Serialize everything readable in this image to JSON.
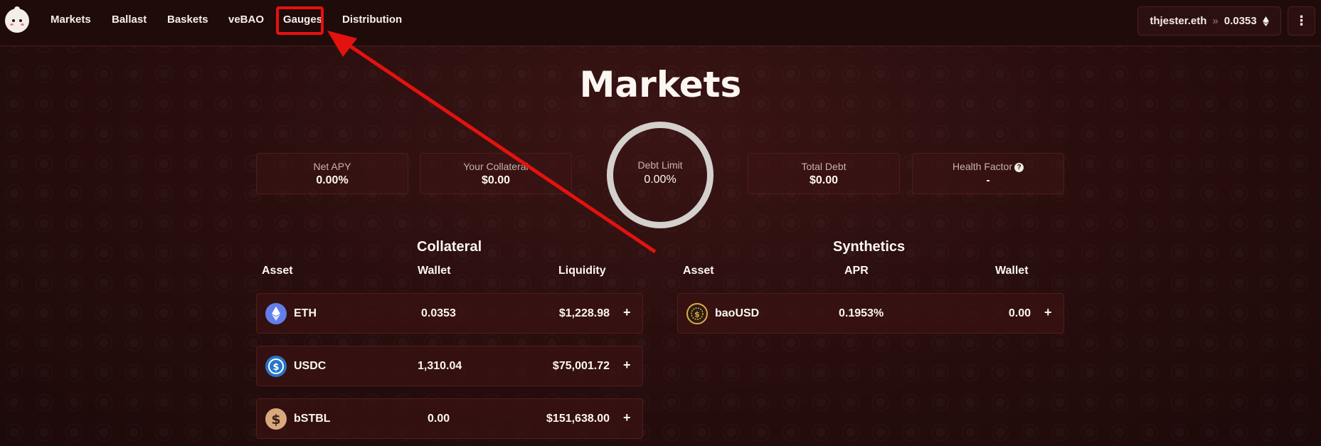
{
  "nav": {
    "links": [
      "Markets",
      "Ballast",
      "Baskets",
      "veBAO",
      "Gauges",
      "Distribution"
    ],
    "wallet": {
      "account": "thjester.eth",
      "separator": "»",
      "balance": "0.0353"
    },
    "menu_glyph": "⋮"
  },
  "page": {
    "title": "Markets"
  },
  "stats": {
    "net_apy": {
      "label": "Net APY",
      "value": "0.00%"
    },
    "your_collateral": {
      "label": "Your Collateral",
      "value": "$0.00"
    },
    "debt_limit": {
      "label": "Debt Limit",
      "value": "0.00%"
    },
    "total_debt": {
      "label": "Total Debt",
      "value": "$0.00"
    },
    "health_factor": {
      "label": "Health Factor",
      "help": "?",
      "value": "-"
    }
  },
  "collateral": {
    "title": "Collateral",
    "columns": [
      "Asset",
      "Wallet",
      "Liquidity"
    ],
    "rows": [
      {
        "asset": "ETH",
        "wallet": "0.0353",
        "liquidity": "$1,228.98",
        "icon": "eth-icon"
      },
      {
        "asset": "USDC",
        "wallet": "1,310.04",
        "liquidity": "$75,001.72",
        "icon": "usdc-icon"
      },
      {
        "asset": "bSTBL",
        "wallet": "0.00",
        "liquidity": "$151,638.00",
        "icon": "bstbl-icon"
      }
    ],
    "action": "+"
  },
  "synthetics": {
    "title": "Synthetics",
    "columns": [
      "Asset",
      "APR",
      "Wallet"
    ],
    "rows": [
      {
        "asset": "baoUSD",
        "apr": "0.1953%",
        "wallet": "0.00",
        "icon": "baousd-icon"
      }
    ],
    "action": "+"
  },
  "colors": {
    "accent_red": "#e3120f",
    "background": "#2a0e0e",
    "card": "#3a1313"
  }
}
